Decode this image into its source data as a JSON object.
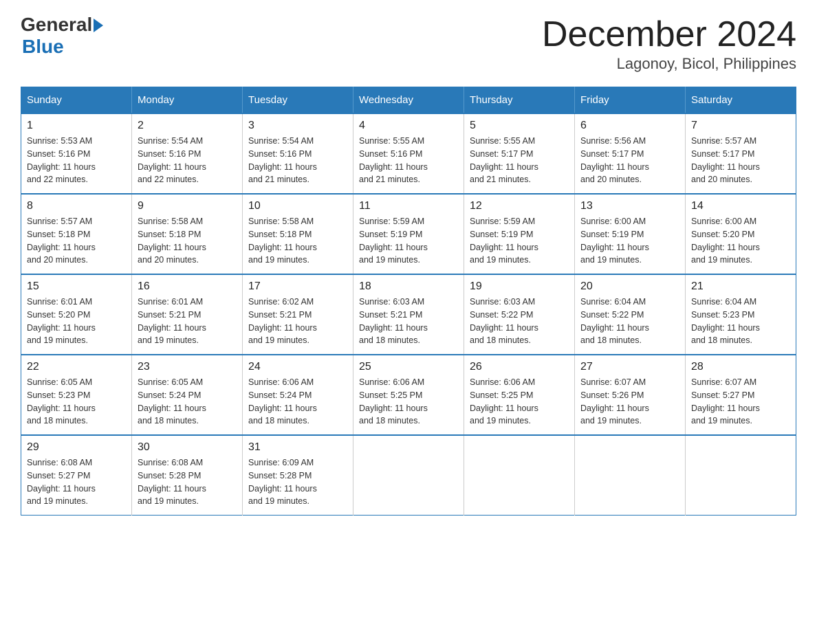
{
  "header": {
    "logo_general": "General",
    "logo_blue": "Blue",
    "title": "December 2024",
    "subtitle": "Lagonoy, Bicol, Philippines"
  },
  "calendar": {
    "headers": [
      "Sunday",
      "Monday",
      "Tuesday",
      "Wednesday",
      "Thursday",
      "Friday",
      "Saturday"
    ],
    "weeks": [
      [
        {
          "day": "1",
          "sunrise": "5:53 AM",
          "sunset": "5:16 PM",
          "daylight": "11 hours and 22 minutes."
        },
        {
          "day": "2",
          "sunrise": "5:54 AM",
          "sunset": "5:16 PM",
          "daylight": "11 hours and 22 minutes."
        },
        {
          "day": "3",
          "sunrise": "5:54 AM",
          "sunset": "5:16 PM",
          "daylight": "11 hours and 21 minutes."
        },
        {
          "day": "4",
          "sunrise": "5:55 AM",
          "sunset": "5:16 PM",
          "daylight": "11 hours and 21 minutes."
        },
        {
          "day": "5",
          "sunrise": "5:55 AM",
          "sunset": "5:17 PM",
          "daylight": "11 hours and 21 minutes."
        },
        {
          "day": "6",
          "sunrise": "5:56 AM",
          "sunset": "5:17 PM",
          "daylight": "11 hours and 20 minutes."
        },
        {
          "day": "7",
          "sunrise": "5:57 AM",
          "sunset": "5:17 PM",
          "daylight": "11 hours and 20 minutes."
        }
      ],
      [
        {
          "day": "8",
          "sunrise": "5:57 AM",
          "sunset": "5:18 PM",
          "daylight": "11 hours and 20 minutes."
        },
        {
          "day": "9",
          "sunrise": "5:58 AM",
          "sunset": "5:18 PM",
          "daylight": "11 hours and 20 minutes."
        },
        {
          "day": "10",
          "sunrise": "5:58 AM",
          "sunset": "5:18 PM",
          "daylight": "11 hours and 19 minutes."
        },
        {
          "day": "11",
          "sunrise": "5:59 AM",
          "sunset": "5:19 PM",
          "daylight": "11 hours and 19 minutes."
        },
        {
          "day": "12",
          "sunrise": "5:59 AM",
          "sunset": "5:19 PM",
          "daylight": "11 hours and 19 minutes."
        },
        {
          "day": "13",
          "sunrise": "6:00 AM",
          "sunset": "5:19 PM",
          "daylight": "11 hours and 19 minutes."
        },
        {
          "day": "14",
          "sunrise": "6:00 AM",
          "sunset": "5:20 PM",
          "daylight": "11 hours and 19 minutes."
        }
      ],
      [
        {
          "day": "15",
          "sunrise": "6:01 AM",
          "sunset": "5:20 PM",
          "daylight": "11 hours and 19 minutes."
        },
        {
          "day": "16",
          "sunrise": "6:01 AM",
          "sunset": "5:21 PM",
          "daylight": "11 hours and 19 minutes."
        },
        {
          "day": "17",
          "sunrise": "6:02 AM",
          "sunset": "5:21 PM",
          "daylight": "11 hours and 19 minutes."
        },
        {
          "day": "18",
          "sunrise": "6:03 AM",
          "sunset": "5:21 PM",
          "daylight": "11 hours and 18 minutes."
        },
        {
          "day": "19",
          "sunrise": "6:03 AM",
          "sunset": "5:22 PM",
          "daylight": "11 hours and 18 minutes."
        },
        {
          "day": "20",
          "sunrise": "6:04 AM",
          "sunset": "5:22 PM",
          "daylight": "11 hours and 18 minutes."
        },
        {
          "day": "21",
          "sunrise": "6:04 AM",
          "sunset": "5:23 PM",
          "daylight": "11 hours and 18 minutes."
        }
      ],
      [
        {
          "day": "22",
          "sunrise": "6:05 AM",
          "sunset": "5:23 PM",
          "daylight": "11 hours and 18 minutes."
        },
        {
          "day": "23",
          "sunrise": "6:05 AM",
          "sunset": "5:24 PM",
          "daylight": "11 hours and 18 minutes."
        },
        {
          "day": "24",
          "sunrise": "6:06 AM",
          "sunset": "5:24 PM",
          "daylight": "11 hours and 18 minutes."
        },
        {
          "day": "25",
          "sunrise": "6:06 AM",
          "sunset": "5:25 PM",
          "daylight": "11 hours and 18 minutes."
        },
        {
          "day": "26",
          "sunrise": "6:06 AM",
          "sunset": "5:25 PM",
          "daylight": "11 hours and 19 minutes."
        },
        {
          "day": "27",
          "sunrise": "6:07 AM",
          "sunset": "5:26 PM",
          "daylight": "11 hours and 19 minutes."
        },
        {
          "day": "28",
          "sunrise": "6:07 AM",
          "sunset": "5:27 PM",
          "daylight": "11 hours and 19 minutes."
        }
      ],
      [
        {
          "day": "29",
          "sunrise": "6:08 AM",
          "sunset": "5:27 PM",
          "daylight": "11 hours and 19 minutes."
        },
        {
          "day": "30",
          "sunrise": "6:08 AM",
          "sunset": "5:28 PM",
          "daylight": "11 hours and 19 minutes."
        },
        {
          "day": "31",
          "sunrise": "6:09 AM",
          "sunset": "5:28 PM",
          "daylight": "11 hours and 19 minutes."
        },
        null,
        null,
        null,
        null
      ]
    ],
    "labels": {
      "sunrise": "Sunrise:",
      "sunset": "Sunset:",
      "daylight": "Daylight:"
    }
  }
}
